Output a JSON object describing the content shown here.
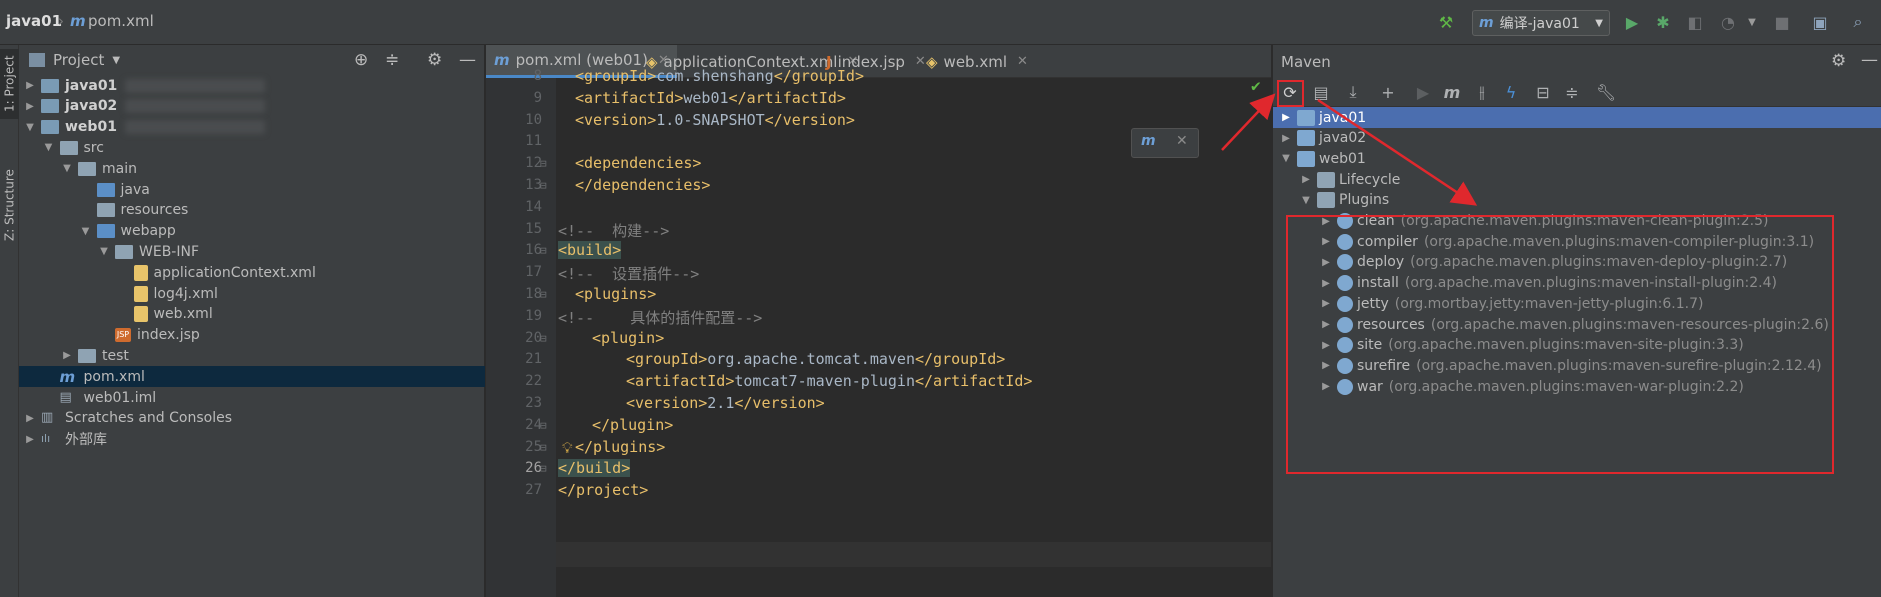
{
  "breadcrumb": {
    "project": "java01",
    "file": "pom.xml"
  },
  "toolbar": {
    "run_config": "编译-java01"
  },
  "side_tabs": {
    "project_tab": "1: Project",
    "structure_tab": "Z: Structure"
  },
  "project_panel": {
    "title": "Project",
    "tree": [
      {
        "label": "java01",
        "depth": 0,
        "expanded": false,
        "icon": "module-folder",
        "bold": true
      },
      {
        "label": "java02",
        "depth": 0,
        "expanded": false,
        "icon": "module-folder",
        "bold": true
      },
      {
        "label": "web01",
        "depth": 0,
        "expanded": true,
        "icon": "module-folder",
        "bold": true
      },
      {
        "label": "src",
        "depth": 1,
        "expanded": true,
        "icon": "folder"
      },
      {
        "label": "main",
        "depth": 2,
        "expanded": true,
        "icon": "folder"
      },
      {
        "label": "java",
        "depth": 3,
        "icon": "source-folder"
      },
      {
        "label": "resources",
        "depth": 3,
        "icon": "resources-folder"
      },
      {
        "label": "webapp",
        "depth": 3,
        "expanded": true,
        "icon": "web-folder"
      },
      {
        "label": "WEB-INF",
        "depth": 4,
        "expanded": true,
        "icon": "folder"
      },
      {
        "label": "applicationContext.xml",
        "depth": 5,
        "icon": "spring-xml"
      },
      {
        "label": "log4j.xml",
        "depth": 5,
        "icon": "xml"
      },
      {
        "label": "web.xml",
        "depth": 5,
        "icon": "web-xml"
      },
      {
        "label": "index.jsp",
        "depth": 4,
        "icon": "jsp"
      },
      {
        "label": "test",
        "depth": 2,
        "expanded": false,
        "icon": "folder"
      },
      {
        "label": "pom.xml",
        "depth": 1,
        "icon": "maven",
        "selected": true
      },
      {
        "label": "web01.iml",
        "depth": 1,
        "icon": "iml"
      },
      {
        "label": "Scratches and Consoles",
        "depth": 0,
        "expanded": false,
        "icon": "scratches"
      },
      {
        "label": "外部库",
        "depth": 0,
        "expanded": false,
        "icon": "libraries"
      }
    ]
  },
  "editor_tabs": [
    {
      "label": "pom.xml (web01)",
      "active": true
    },
    {
      "label": "applicationContext.xml"
    },
    {
      "label": "index.jsp"
    },
    {
      "label": "web.xml"
    }
  ],
  "code_lines": [
    {
      "num": "8",
      "text": "<groupId>com.shenshang</groupId>"
    },
    {
      "num": "9",
      "text": "<artifactId>web01</artifactId>"
    },
    {
      "num": "10",
      "text": "<version>1.0-SNAPSHOT</version>"
    },
    {
      "num": "11",
      "text": ""
    },
    {
      "num": "12",
      "text": "<dependencies>"
    },
    {
      "num": "13",
      "text": "</dependencies>"
    },
    {
      "num": "14",
      "text": ""
    },
    {
      "num": "15",
      "text": "<!--  构建-->"
    },
    {
      "num": "16",
      "text": "<build>"
    },
    {
      "num": "17",
      "text": "<!--  设置插件-->"
    },
    {
      "num": "18",
      "text": "<plugins>"
    },
    {
      "num": "19",
      "text": "<!--    具体的插件配置-->"
    },
    {
      "num": "20",
      "text": "<plugin>"
    },
    {
      "num": "21",
      "text": "<groupId>org.apache.tomcat.maven</groupId>"
    },
    {
      "num": "22",
      "text": "<artifactId>tomcat7-maven-plugin</artifactId>"
    },
    {
      "num": "23",
      "text": "<version>2.1</version>"
    },
    {
      "num": "24",
      "text": "</plugin>"
    },
    {
      "num": "25",
      "text": "</plugins>"
    },
    {
      "num": "26",
      "text": "</build>"
    },
    {
      "num": "27",
      "text": "</project>"
    }
  ],
  "maven_panel": {
    "title": "Maven",
    "tree": [
      {
        "label": "java01",
        "depth": 0,
        "selected": true
      },
      {
        "label": "java02",
        "depth": 0
      },
      {
        "label": "web01",
        "depth": 0,
        "expanded": true
      },
      {
        "label": "Lifecycle",
        "depth": 1
      },
      {
        "label": "Plugins",
        "depth": 1,
        "expanded": true
      }
    ],
    "plugins": [
      {
        "name": "clean",
        "coord": "(org.apache.maven.plugins:maven-clean-plugin:2.5)"
      },
      {
        "name": "compiler",
        "coord": "(org.apache.maven.plugins:maven-compiler-plugin:3.1)"
      },
      {
        "name": "deploy",
        "coord": "(org.apache.maven.plugins:maven-deploy-plugin:2.7)"
      },
      {
        "name": "install",
        "coord": "(org.apache.maven.plugins:maven-install-plugin:2.4)"
      },
      {
        "name": "jetty",
        "coord": "(org.mortbay.jetty:maven-jetty-plugin:6.1.7)"
      },
      {
        "name": "resources",
        "coord": "(org.apache.maven.plugins:maven-resources-plugin:2.6)"
      },
      {
        "name": "site",
        "coord": "(org.apache.maven.plugins:maven-site-plugin:3.3)"
      },
      {
        "name": "surefire",
        "coord": "(org.apache.maven.plugins:maven-surefire-plugin:2.12.4)"
      },
      {
        "name": "war",
        "coord": "(org.apache.maven.plugins:maven-war-plugin:2.2)"
      }
    ]
  },
  "colors": {
    "annotation": "#e0282d",
    "selection": "#4b6eaf",
    "tag": "#e8bf6a",
    "comment": "#808080"
  }
}
